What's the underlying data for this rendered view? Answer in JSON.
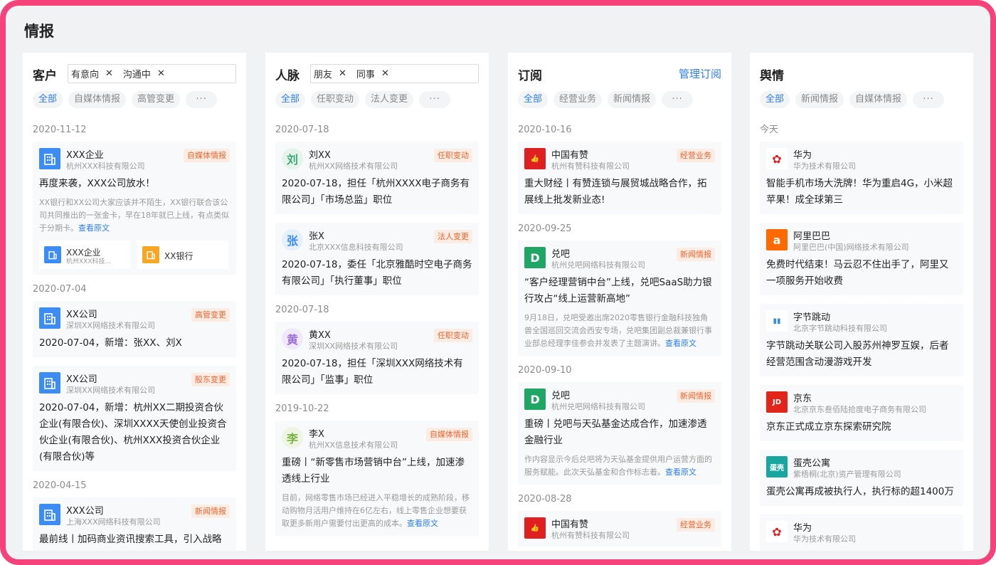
{
  "page_title": "情报",
  "columns": [
    {
      "title": "客户",
      "link": "",
      "tags": [
        "有意向",
        "沟通中"
      ],
      "chips": [
        "全部",
        "自媒体情报",
        "高管变更"
      ],
      "more": "···",
      "groups": [
        {
          "date": "2020-11-12",
          "cards": [
            {
              "icon": "building-icon",
              "logo_text": "",
              "logo_bg": "#3d8bf5",
              "name": "XXX企业",
              "sub": "杭州XXX科技有限公司",
              "badge": "自媒体情报",
              "badge_color": "#f0642c",
              "badge_bg": "#fdece4",
              "title": "再度来袭，XXX公司放水！",
              "body": "XX银行和XX公司大家应该并不陌生，XX银行联合该公司共同推出的一张金卡，早在18年就已上线，有点类似于分期卡。",
              "body_link": "查看原文",
              "related": [
                {
                  "icon": "building-icon",
                  "bg": "#3d8bf5",
                  "name": "XXX企业",
                  "sub": "杭州XXX科技..."
                },
                {
                  "icon": "bank-icon",
                  "bg": "#f5a623",
                  "name": "XX银行",
                  "sub": ""
                }
              ]
            }
          ]
        },
        {
          "date": "2020-07-04",
          "cards": [
            {
              "icon": "building-icon",
              "logo_text": "",
              "logo_bg": "#3d8bf5",
              "name": "XX公司",
              "sub": "深圳XX网络技术有限公司",
              "badge": "高管变更",
              "badge_color": "#f0642c",
              "badge_bg": "#fdece4",
              "title": "2020-07-04，新增：张XX、刘X",
              "body": "",
              "body_link": "",
              "related": []
            },
            {
              "icon": "building-icon",
              "logo_text": "",
              "logo_bg": "#3d8bf5",
              "name": "XX公司",
              "sub": "深圳XX网络技术有限公司",
              "badge": "股东变更",
              "badge_color": "#f0642c",
              "badge_bg": "#fdece4",
              "title": "2020-07-04，新增：杭州XX二期投资合伙企业(有限合伙)、深圳XXXX天使创业投资合伙企业(有限合伙)、杭州XXX投资合伙企业(有限合伙)等",
              "body": "",
              "body_link": "",
              "related": []
            }
          ]
        },
        {
          "date": "2020-04-15",
          "cards": [
            {
              "icon": "building-icon",
              "logo_text": "",
              "logo_bg": "#3d8bf5",
              "name": "XXX公司",
              "sub": "上海XXX网络科技有限公司",
              "badge": "新闻情报",
              "badge_color": "#f0642c",
              "badge_bg": "#fdece4",
              "title": "最前线丨加码商业资讯搜索工具，引入战略",
              "body": "",
              "body_link": "",
              "related": []
            }
          ]
        }
      ]
    },
    {
      "title": "人脉",
      "link": "",
      "tags": [
        "朋友",
        "同事"
      ],
      "chips": [
        "全部",
        "任职变动",
        "法人变更"
      ],
      "more": "···",
      "groups": [
        {
          "date": "2020-07-18",
          "cards": [
            {
              "icon": "avatar-icon",
              "logo_text": "刘",
              "logo_bg": "#e6f3ec",
              "logo_color": "#3aa776",
              "round": true,
              "name": "刘XX",
              "sub": "杭州XX网络技术有限公司",
              "badge": "任职变动",
              "badge_color": "#f0642c",
              "badge_bg": "#fdece4",
              "title": "2020-07-18，担任「杭州XXXX电子商务有限公司」「市场总监」职位",
              "body": "",
              "body_link": "",
              "related": []
            },
            {
              "icon": "avatar-icon",
              "logo_text": "张",
              "logo_bg": "#e6f0fd",
              "logo_color": "#3d8bf5",
              "round": true,
              "name": "张X",
              "sub": "北京XXX信息科技有限公司",
              "badge": "法人变更",
              "badge_color": "#f0642c",
              "badge_bg": "#fdece4",
              "title": "2020-07-18，委任「北京雅酷时空电子商务有限公司」「执行董事」职位",
              "body": "",
              "body_link": "",
              "related": []
            }
          ]
        },
        {
          "date": "2020-07-18",
          "cards": [
            {
              "icon": "avatar-icon",
              "logo_text": "黄",
              "logo_bg": "#f0e9fb",
              "logo_color": "#9b6cd9",
              "round": true,
              "name": "黄XX",
              "sub": "深圳XX网络技术有限公司",
              "badge": "任职变动",
              "badge_color": "#f0642c",
              "badge_bg": "#fdece4",
              "title": "2020-07-18，担任「深圳XXX网络技术有限公司」「监事」职位",
              "body": "",
              "body_link": "",
              "related": []
            }
          ]
        },
        {
          "date": "2019-10-22",
          "cards": [
            {
              "icon": "avatar-icon",
              "logo_text": "李",
              "logo_bg": "#eef6e3",
              "logo_color": "#7cb342",
              "round": true,
              "name": "李X",
              "sub": "杭州XX信息技术有限公司",
              "badge": "自媒体情报",
              "badge_color": "#f0642c",
              "badge_bg": "#fdece4",
              "title": "重磅丨“新零售市场营销中台”上线，加速渗透线上行业",
              "body": "目前，网络零售市场已经进入平稳增长的成熟阶段，移动购物月活用户维持在6亿左右，线上零售企业想要获取更多新用户需要付出更高的成本。",
              "body_link": "查看原文",
              "related": []
            }
          ]
        }
      ]
    },
    {
      "title": "订阅",
      "link": "管理订阅",
      "tags": [],
      "chips": [
        "全部",
        "经营业务",
        "新闻情报"
      ],
      "more": "···",
      "groups": [
        {
          "date": "2020-10-16",
          "cards": [
            {
              "icon": "thumbs-up-icon",
              "logo_text": "👍",
              "logo_bg": "#e02020",
              "name": "中国有赞",
              "sub": "杭州有赞科技有限公司",
              "badge": "经营业务",
              "badge_color": "#f0642c",
              "badge_bg": "#fdece4",
              "title": "重大财经丨有赞连锁与展贸城战略合作，拓展线上批发新业态!",
              "body": "",
              "body_link": "",
              "related": []
            }
          ]
        },
        {
          "date": "2020-09-25",
          "cards": [
            {
              "icon": "duiba-icon",
              "logo_text": "D",
              "logo_bg": "#1fa564",
              "name": "兑吧",
              "sub": "杭州兑吧网络科技有限公司",
              "badge": "新闻情报",
              "badge_color": "#f0642c",
              "badge_bg": "#fdece4",
              "title": "“客户经理营销中台”上线，兑吧SaaS助力银行攻占“线上运营新高地”",
              "body": "9月18日，兑吧受邀出席2020零售银行金融科技独角兽全国巡回交流会西安专场，兑吧集团副总裁兼银行事业部总经理李佳参会并发表了主题演讲。",
              "body_link": "查看原文",
              "related": []
            }
          ]
        },
        {
          "date": "2020-09-10",
          "cards": [
            {
              "icon": "duiba-icon",
              "logo_text": "D",
              "logo_bg": "#1fa564",
              "name": "兑吧",
              "sub": "杭州兑吧网络科技有限公司",
              "badge": "新闻情报",
              "badge_color": "#f0642c",
              "badge_bg": "#fdece4",
              "title": "重磅丨兑吧与天弘基金达成合作，加速渗透金融行业",
              "body": "作内容显示今后兑吧将为天弘基金提供用户运营方面的服务赋能。此次天弘基金和合作标志着。",
              "body_link": "查看原文",
              "related": []
            }
          ]
        },
        {
          "date": "2020-08-28",
          "cards": [
            {
              "icon": "thumbs-up-icon",
              "logo_text": "👍",
              "logo_bg": "#e02020",
              "name": "中国有赞",
              "sub": "杭州有赞科技有限公司",
              "badge": "经营业务",
              "badge_color": "#f0642c",
              "badge_bg": "#fdece4",
              "title": "",
              "body": "",
              "body_link": "",
              "related": []
            }
          ]
        }
      ]
    },
    {
      "title": "舆情",
      "link": "",
      "tags": [],
      "chips": [
        "全部",
        "新闻情报",
        "自媒体情报"
      ],
      "more": "···",
      "groups": [
        {
          "date": "今天",
          "cards": [
            {
              "icon": "huawei-icon",
              "logo_text": "✿",
              "logo_bg": "#ffffff",
              "logo_color": "#e02020",
              "name": "华为",
              "sub": "华为技术有限公司",
              "badge": "",
              "title": "智能手机市场大洗牌！华为重启4G，小米超苹果！成全球第三",
              "body": "",
              "body_link": "",
              "related": []
            },
            {
              "icon": "alibaba-icon",
              "logo_text": "a",
              "logo_bg": "#ff6a00",
              "name": "阿里巴巴",
              "sub": "阿里巴巴(中国)网络技术有限公司",
              "badge": "",
              "title": "免费时代结束！马云忍不住出手了，阿里又一项服务开始收费",
              "body": "",
              "body_link": "",
              "related": []
            },
            {
              "icon": "bytedance-icon",
              "logo_text": "▮▮",
              "logo_bg": "#ffffff",
              "logo_color": "#3c8ce7",
              "name": "字节跳动",
              "sub": "北京字节跳动科技有限公司",
              "badge": "",
              "title": "字节跳动关联公司入股苏州神罗互娱，后者经营范围含动漫游戏开发",
              "body": "",
              "body_link": "",
              "related": []
            },
            {
              "icon": "jd-icon",
              "logo_text": "JD",
              "logo_bg": "#e1251b",
              "name": "京东",
              "sub": "北京京东叁佰陆拾度电子商务有限公司",
              "badge": "",
              "title": "京东正式成立京东探索研究院",
              "body": "",
              "body_link": "",
              "related": []
            },
            {
              "icon": "danke-icon",
              "logo_text": "蛋壳",
              "logo_bg": "#19a5a0",
              "name": "蛋壳公寓",
              "sub": "紫梧桐(北京)资产管理有限公司",
              "badge": "",
              "title": "蛋壳公寓再成被执行人，执行标的超1400万",
              "body": "",
              "body_link": "",
              "related": []
            },
            {
              "icon": "huawei-icon",
              "logo_text": "✿",
              "logo_bg": "#ffffff",
              "logo_color": "#e02020",
              "name": "华为",
              "sub": "华为技术有限公司",
              "badge": "",
              "title": "",
              "body": "",
              "body_link": "",
              "related": []
            }
          ]
        }
      ]
    }
  ]
}
